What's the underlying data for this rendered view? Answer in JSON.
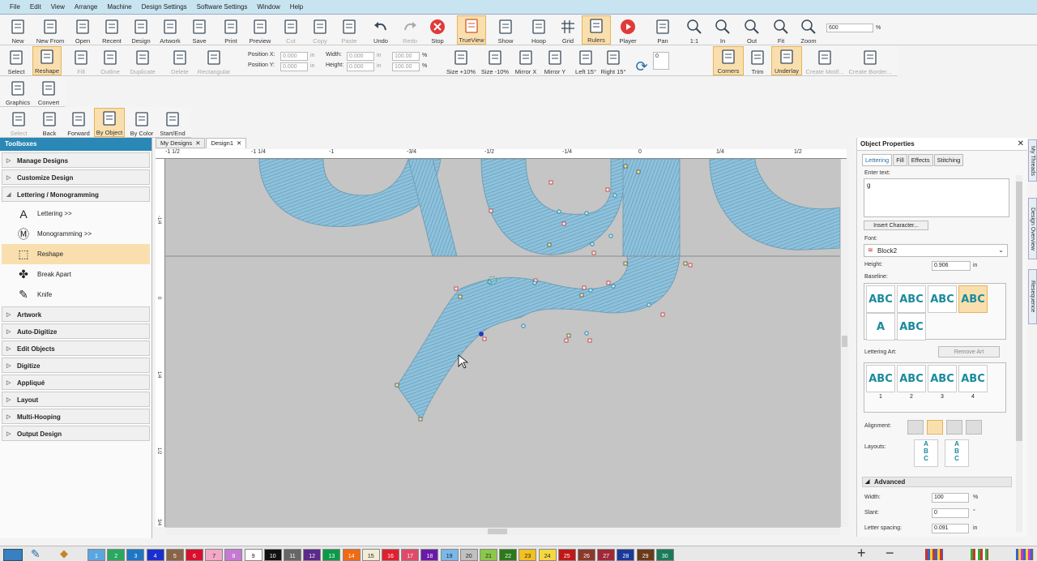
{
  "menu": [
    "File",
    "Edit",
    "View",
    "Arrange",
    "Machine",
    "Design Settings",
    "Software Settings",
    "Window",
    "Help"
  ],
  "toolbar1": [
    {
      "label": "New",
      "icon": "new-doc-icon",
      "state": "normal"
    },
    {
      "label": "New From",
      "icon": "new-from-icon",
      "state": "normal"
    },
    {
      "label": "Open",
      "icon": "open-folder-icon",
      "state": "normal"
    },
    {
      "label": "Recent",
      "icon": "recent-icon",
      "state": "normal"
    },
    {
      "label": "Design",
      "icon": "design-icon",
      "state": "normal"
    },
    {
      "label": "Artwork",
      "icon": "artwork-icon",
      "state": "normal"
    },
    {
      "label": "Save",
      "icon": "save-icon",
      "state": "normal"
    },
    {
      "label": "Print",
      "icon": "print-icon",
      "state": "normal"
    },
    {
      "label": "Preview",
      "icon": "preview-icon",
      "state": "normal"
    },
    {
      "label": "Cut",
      "icon": "cut-icon",
      "state": "disabled"
    },
    {
      "label": "Copy",
      "icon": "copy-icon",
      "state": "disabled"
    },
    {
      "label": "Paste",
      "icon": "paste-icon",
      "state": "disabled"
    },
    {
      "label": "Undo",
      "icon": "undo-icon",
      "state": "normal"
    },
    {
      "label": "Redo",
      "icon": "redo-icon",
      "state": "disabled"
    },
    {
      "label": "Stop",
      "icon": "stop-icon",
      "state": "normal"
    },
    {
      "label": "TrueView",
      "icon": "trueview-icon",
      "state": "active"
    },
    {
      "label": "Show",
      "icon": "show-icon",
      "state": "normal"
    },
    {
      "label": "Hoop",
      "icon": "hoop-icon",
      "state": "normal"
    },
    {
      "label": "Grid",
      "icon": "grid-icon",
      "state": "normal"
    },
    {
      "label": "Rulers",
      "icon": "rulers-icon",
      "state": "active"
    },
    {
      "label": "Player",
      "icon": "player-icon",
      "state": "normal"
    },
    {
      "label": "Pan",
      "icon": "pan-hand-icon",
      "state": "normal"
    },
    {
      "label": "1:1",
      "icon": "zoom-1to1-icon",
      "state": "normal"
    },
    {
      "label": "In",
      "icon": "zoom-in-icon",
      "state": "normal"
    },
    {
      "label": "Out",
      "icon": "zoom-out-icon",
      "state": "normal"
    },
    {
      "label": "Fit",
      "icon": "zoom-fit-icon",
      "state": "normal"
    },
    {
      "label": "Zoom",
      "icon": "zoom-icon",
      "state": "normal"
    }
  ],
  "zoom": {
    "value": "600",
    "unit": "%"
  },
  "toolbar2": [
    {
      "label": "Select",
      "state": "normal"
    },
    {
      "label": "Reshape",
      "state": "active"
    },
    {
      "label": "Fill",
      "state": "disabled"
    },
    {
      "label": "Outline",
      "state": "disabled"
    },
    {
      "label": "Duplicate",
      "state": "disabled"
    },
    {
      "label": "Delete",
      "state": "disabled"
    },
    {
      "label": "Rectangular",
      "state": "disabled"
    }
  ],
  "position": {
    "x_label": "Position X:",
    "y_label": "Position Y:",
    "x": "0.000",
    "y": "0.000",
    "unit": "in"
  },
  "size": {
    "w_label": "Width:",
    "h_label": "Height:",
    "w": "0.000",
    "h": "0.000",
    "unit": "in",
    "pw": "100.00",
    "ph": "100.00",
    "pct": "%"
  },
  "toolbar2b": [
    {
      "label": "Size +10%",
      "state": "normal"
    },
    {
      "label": "Size -10%",
      "state": "normal"
    },
    {
      "label": "Mirror X",
      "state": "normal"
    },
    {
      "label": "Mirror Y",
      "state": "normal"
    },
    {
      "label": "Left 15°",
      "state": "normal"
    },
    {
      "label": "Right 15°",
      "state": "normal"
    },
    {
      "label": "Corners",
      "state": "active"
    },
    {
      "label": "Trim",
      "state": "normal"
    },
    {
      "label": "Underlay",
      "state": "active"
    },
    {
      "label": "Create Motif...",
      "state": "disabled"
    },
    {
      "label": "Create Border...",
      "state": "disabled"
    }
  ],
  "rotate_value": "0",
  "toolbar3": [
    {
      "label": "Graphics",
      "state": "normal"
    },
    {
      "label": "Convert",
      "state": "normal"
    }
  ],
  "toolbar4": [
    {
      "label": "Select",
      "state": "disabled"
    },
    {
      "label": "Back",
      "state": "normal"
    },
    {
      "label": "Forward",
      "state": "normal"
    },
    {
      "label": "By Object",
      "state": "active"
    },
    {
      "label": "By Color",
      "state": "normal"
    },
    {
      "label": "Start/End",
      "state": "normal"
    }
  ],
  "toolboxes": {
    "title": "Toolboxes",
    "sections_top": [
      "Manage Designs",
      "Customize Design"
    ],
    "open_section": "Lettering / Monogramming",
    "tools": [
      {
        "label": "Lettering >>",
        "icon": "lettering-icon",
        "selected": false
      },
      {
        "label": "Monogramming >>",
        "icon": "monogram-icon",
        "selected": false
      },
      {
        "label": "Reshape",
        "icon": "reshape-icon",
        "selected": true
      },
      {
        "label": "Break Apart",
        "icon": "break-apart-icon",
        "selected": false
      },
      {
        "label": "Knife",
        "icon": "knife-icon",
        "selected": false
      }
    ],
    "sections_bottom": [
      "Artwork",
      "Auto-Digitize",
      "Edit Objects",
      "Digitize",
      "Appliqué",
      "Layout",
      "Multi-Hooping",
      "Output Design"
    ]
  },
  "doc_tabs": [
    "My Designs",
    "Design1"
  ],
  "ruler_top": [
    "-1 1/2",
    "-1 1/4",
    "-1",
    "-3/4",
    "-1/2",
    "-1/4",
    "0",
    "1/4",
    "1/2"
  ],
  "ruler_left": [
    "-1/4",
    "0",
    "1/4",
    "1/2",
    "3/4"
  ],
  "props": {
    "title": "Object Properties",
    "tabs": [
      "Lettering",
      "Fill",
      "Effects",
      "Stitching"
    ],
    "enter_text_label": "Enter text:",
    "text_value": "g",
    "insert_char": "Insert Character...",
    "font_label": "Font:",
    "font_value": "Block2",
    "height_label": "Height:",
    "height_value": "0.906",
    "height_unit": "in",
    "baseline_label": "Baseline:",
    "baseline_items": [
      "ABC",
      "ABC",
      "ABC",
      "ABC",
      "A",
      "ABC"
    ],
    "lettering_art_label": "Lettering Art:",
    "remove_art": "Remove Art",
    "art_items": [
      "ABC",
      "ABC",
      "ABC",
      "ABC"
    ],
    "art_nums": [
      "1",
      "2",
      "3",
      "4"
    ],
    "alignment_label": "Alignment:",
    "layouts_label": "Layouts:",
    "advanced_label": "Advanced",
    "width_label": "Width:",
    "width_value": "100",
    "width_unit": "%",
    "slant_label": "Slant:",
    "slant_value": "0",
    "slant_unit": "°",
    "spacing_label": "Letter spacing:",
    "spacing_value": "0.091",
    "spacing_unit": "in"
  },
  "side_tabs": [
    "My Threads",
    "Design Overview",
    "Resequence"
  ],
  "palette": [
    {
      "n": "1",
      "c": "#5aa7e0"
    },
    {
      "n": "2",
      "c": "#2aa860"
    },
    {
      "n": "3",
      "c": "#1d77c6"
    },
    {
      "n": "4",
      "c": "#1a2fd0"
    },
    {
      "n": "5",
      "c": "#8a6448"
    },
    {
      "n": "6",
      "c": "#d8102e"
    },
    {
      "n": "7",
      "c": "#f2a8c8"
    },
    {
      "n": "8",
      "c": "#c47ad3"
    },
    {
      "n": "9",
      "c": "#ffffff"
    },
    {
      "n": "10",
      "c": "#111111"
    },
    {
      "n": "11",
      "c": "#666666"
    },
    {
      "n": "12",
      "c": "#5b2a8a"
    },
    {
      "n": "13",
      "c": "#0a9a4a"
    },
    {
      "n": "14",
      "c": "#f26a10"
    },
    {
      "n": "15",
      "c": "#f3ecd5"
    },
    {
      "n": "16",
      "c": "#e02030"
    },
    {
      "n": "17",
      "c": "#e04a6a"
    },
    {
      "n": "18",
      "c": "#6a1aa8"
    },
    {
      "n": "19",
      "c": "#7ab8e8"
    },
    {
      "n": "20",
      "c": "#c0c0c0"
    },
    {
      "n": "21",
      "c": "#8ac848"
    },
    {
      "n": "22",
      "c": "#2a7a1a"
    },
    {
      "n": "23",
      "c": "#f2c020"
    },
    {
      "n": "24",
      "c": "#f5d840"
    },
    {
      "n": "25",
      "c": "#c01818"
    },
    {
      "n": "26",
      "c": "#8a3a2a"
    },
    {
      "n": "27",
      "c": "#a02838"
    },
    {
      "n": "28",
      "c": "#1a3a9a"
    },
    {
      "n": "29",
      "c": "#6a3a1a"
    },
    {
      "n": "30",
      "c": "#1a7a5a"
    }
  ],
  "colors": {
    "accent": "#2a87b6",
    "active_bg": "#f9dfae",
    "stitch": "#8ec2dc"
  }
}
